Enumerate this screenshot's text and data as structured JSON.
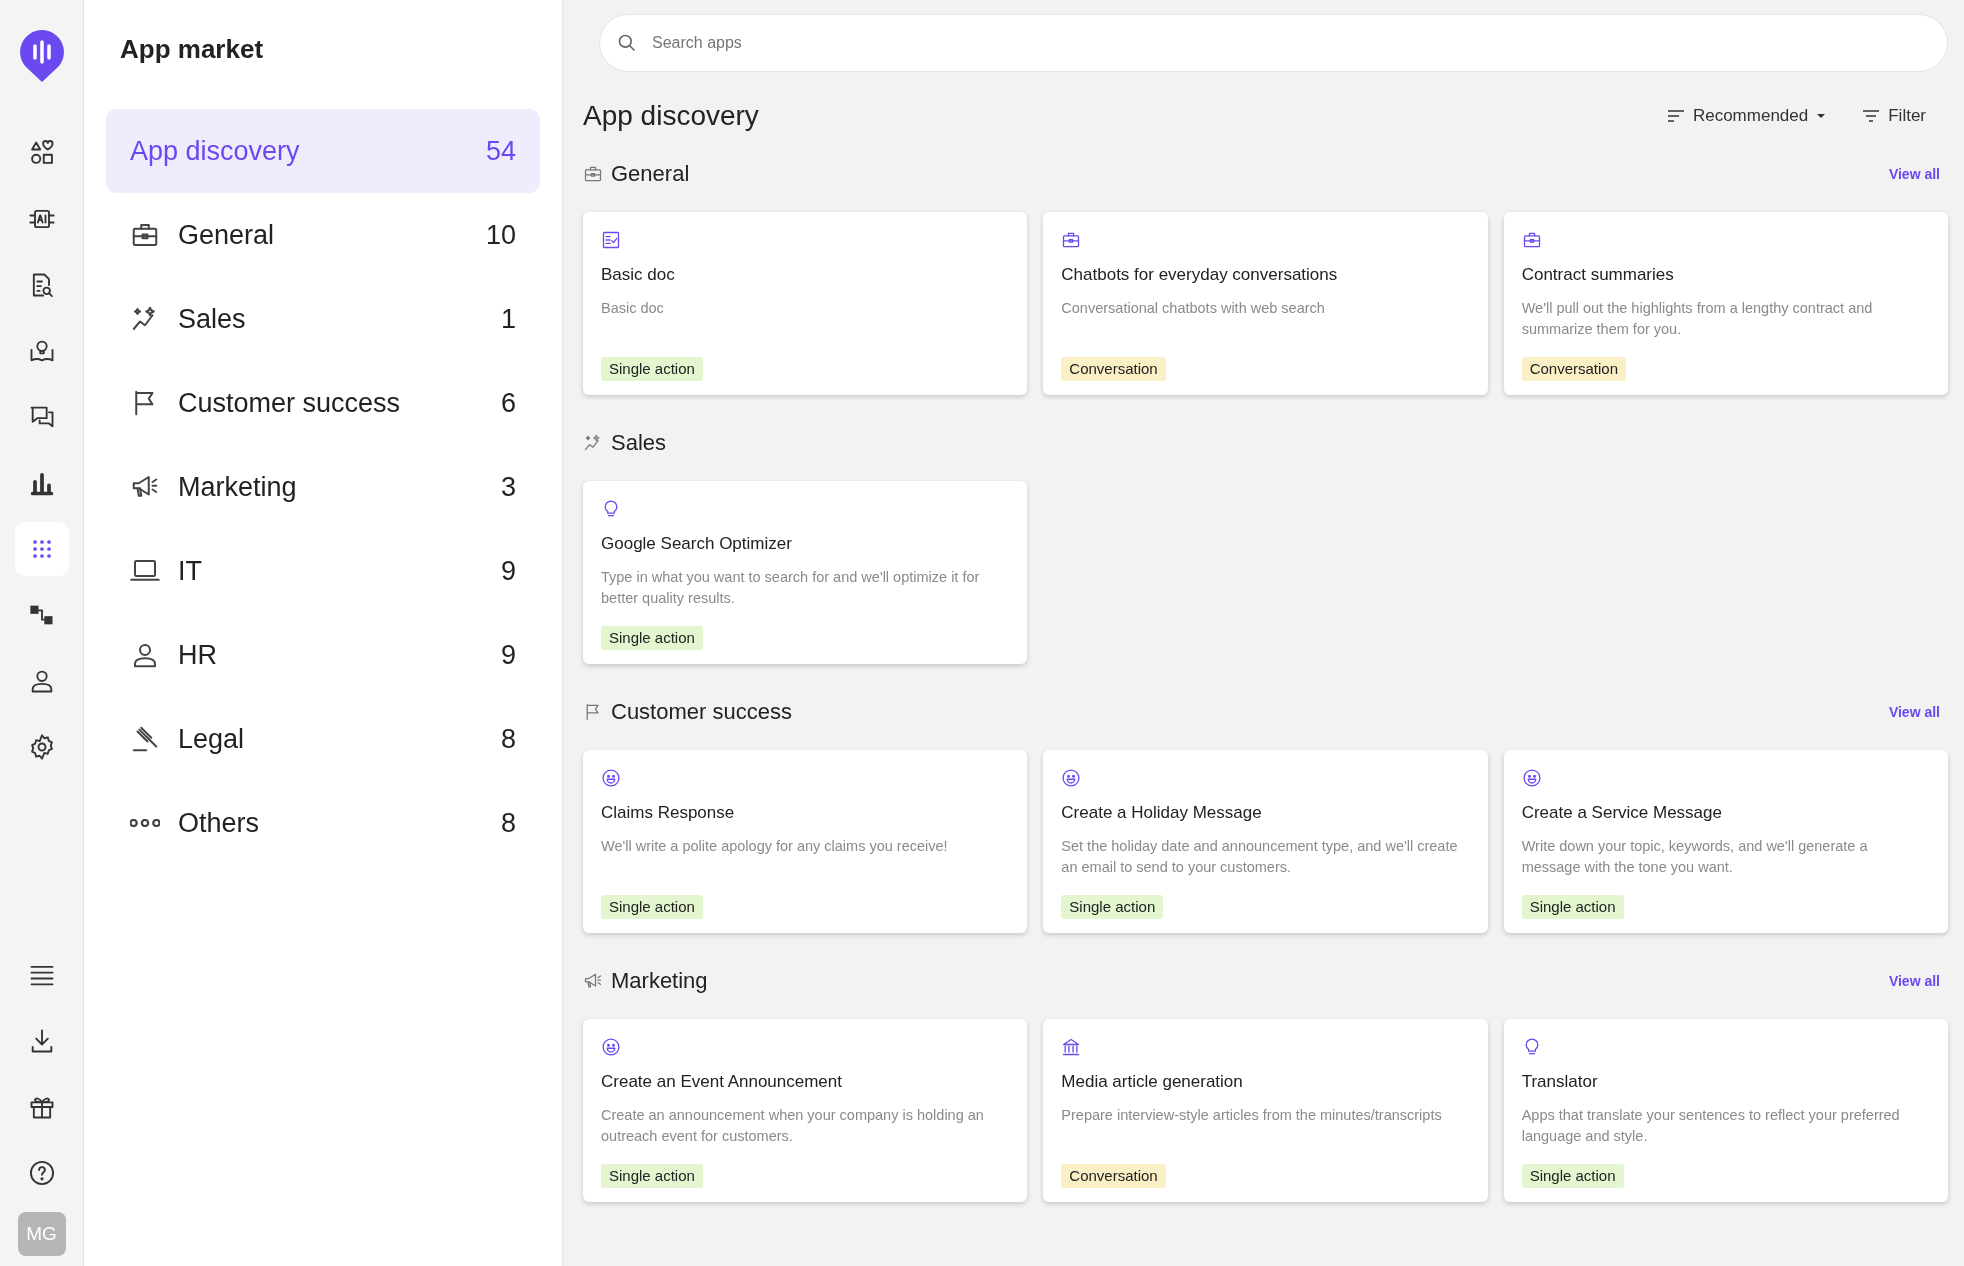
{
  "rail": {
    "items": [
      {
        "selected": false
      },
      {
        "selected": false
      },
      {
        "selected": false
      },
      {
        "selected": false
      },
      {
        "selected": false
      },
      {
        "selected": false
      },
      {
        "selected": true
      },
      {
        "selected": false
      },
      {
        "selected": false
      },
      {
        "selected": false
      }
    ],
    "avatar": "MG"
  },
  "sidebar": {
    "title": "App market",
    "items": [
      {
        "label": "App discovery",
        "count": "54",
        "selected": true
      },
      {
        "label": "General",
        "count": "10",
        "selected": false
      },
      {
        "label": "Sales",
        "count": "1",
        "selected": false
      },
      {
        "label": "Customer success",
        "count": "6",
        "selected": false
      },
      {
        "label": "Marketing",
        "count": "3",
        "selected": false
      },
      {
        "label": "IT",
        "count": "9",
        "selected": false
      },
      {
        "label": "HR",
        "count": "9",
        "selected": false
      },
      {
        "label": "Legal",
        "count": "8",
        "selected": false
      },
      {
        "label": "Others",
        "count": "8",
        "selected": false
      }
    ]
  },
  "search": {
    "placeholder": "Search apps"
  },
  "heading": "App discovery",
  "sort": "Recommended",
  "filter": "Filter",
  "sections": [
    {
      "title": "General",
      "view_all": "View all",
      "apps": [
        {
          "kind": "checklist",
          "title": "Basic doc",
          "description": "Basic doc",
          "tag": {
            "label": "Single action",
            "kind": "single"
          }
        },
        {
          "kind": "briefcase",
          "title": "Chatbots for everyday conversations",
          "description": "Conversational chatbots with web search",
          "tag": {
            "label": "Conversation",
            "kind": "conversation"
          }
        },
        {
          "kind": "briefcase",
          "title": "Contract summaries",
          "description": "We'll pull out the highlights from a lengthy contract and summarize them for you.",
          "tag": {
            "label": "Conversation",
            "kind": "conversation"
          }
        }
      ]
    },
    {
      "title": "Sales",
      "apps": [
        {
          "kind": "bulb",
          "title": "Google Search Optimizer",
          "description": "Type in what you want to search for and we'll optimize it for better quality results.",
          "tag": {
            "label": "Single action",
            "kind": "single"
          }
        }
      ]
    },
    {
      "title": "Customer success",
      "view_all": "View all",
      "apps": [
        {
          "kind": "smiley",
          "title": "Claims Response",
          "description": "We'll write a polite apology for any claims you receive!",
          "tag": {
            "label": "Single action",
            "kind": "single"
          }
        },
        {
          "kind": "smiley",
          "title": "Create a Holiday Message",
          "description": "Set the holiday date and announcement type, and we'll create an email to send to your customers.",
          "tag": {
            "label": "Single action",
            "kind": "single"
          }
        },
        {
          "kind": "smiley",
          "title": "Create a Service Message",
          "description": "Write down your topic, keywords, and we'll generate a message with the tone you want.",
          "tag": {
            "label": "Single action",
            "kind": "single"
          }
        }
      ]
    },
    {
      "title": "Marketing",
      "view_all": "View all",
      "apps": [
        {
          "kind": "smiley",
          "title": "Create an Event Announcement",
          "description": "Create an announcement when your company is holding an outreach event for customers.",
          "tag": {
            "label": "Single action",
            "kind": "single"
          }
        },
        {
          "kind": "bank",
          "title": "Media article generation",
          "description": "Prepare interview-style articles from the minutes/transcripts",
          "tag": {
            "label": "Conversation",
            "kind": "conversation"
          }
        },
        {
          "kind": "bulb",
          "title": "Translator",
          "description": "Apps that translate your sentences to reflect your preferred language and style.",
          "tag": {
            "label": "Single action",
            "kind": "single"
          }
        }
      ]
    }
  ]
}
